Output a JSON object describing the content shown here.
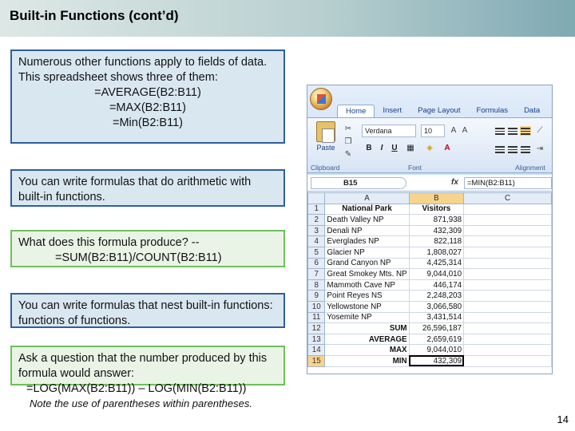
{
  "slide": {
    "title": "Built-in Functions (cont’d)",
    "page_number": "14",
    "note": "Note the use of parentheses within parentheses."
  },
  "boxes": {
    "b1": {
      "line1": "Numerous other functions apply to fields of data.  This spreadsheet shows three of them:",
      "f1": "=AVERAGE(B2:B11)",
      "f2": "=MAX(B2:B11)",
      "f3": "=Min(B2:B11)"
    },
    "b2": {
      "text": "You can write formulas that do arithmetic with built-in functions."
    },
    "b3": {
      "line1": "What does this formula produce? --",
      "formula": "=SUM(B2:B11)/COUNT(B2:B11)"
    },
    "b4": {
      "text": "You can write formulas that nest built-in functions: functions of functions."
    },
    "b5": {
      "line1": "Ask a question that the number produced by this  formula would answer:",
      "formula": "=LOG(MAX(B2:B11)) – LOG(MIN(B2:B11))"
    }
  },
  "excel": {
    "tabs": [
      "Home",
      "Insert",
      "Page Layout",
      "Formulas",
      "Data"
    ],
    "font_name": "Verdana",
    "font_size": "10",
    "paste_label": "Paste",
    "group_labels": {
      "clipboard": "Clipboard",
      "font": "Font",
      "alignment": "Alignment"
    },
    "name_box": "B15",
    "fx_label": "fx",
    "formula": "=MIN(B2:B11)",
    "col_headers": [
      "A",
      "B",
      "C"
    ],
    "rows": [
      {
        "n": "1",
        "a": "National Park",
        "b": "Visitors"
      },
      {
        "n": "2",
        "a": "Death Valley NP",
        "b": "871,938"
      },
      {
        "n": "3",
        "a": "Denali NP",
        "b": "432,309"
      },
      {
        "n": "4",
        "a": "Everglades NP",
        "b": "822,118"
      },
      {
        "n": "5",
        "a": "Glacier NP",
        "b": "1,808,027"
      },
      {
        "n": "6",
        "a": "Grand Canyon NP",
        "b": "4,425,314"
      },
      {
        "n": "7",
        "a": "Great Smokey Mts. NP",
        "b": "9,044,010"
      },
      {
        "n": "8",
        "a": "Mammoth Cave NP",
        "b": "446,174"
      },
      {
        "n": "9",
        "a": "Point Reyes NS",
        "b": "2,248,203"
      },
      {
        "n": "10",
        "a": "Yellowstone NP",
        "b": "3,066,580"
      },
      {
        "n": "11",
        "a": "Yosemite NP",
        "b": "3,431,514"
      },
      {
        "n": "12",
        "a": "SUM",
        "b": "26,596,187"
      },
      {
        "n": "13",
        "a": "AVERAGE",
        "b": "2,659,619"
      },
      {
        "n": "14",
        "a": "MAX",
        "b": "9,044,010"
      },
      {
        "n": "15",
        "a": "MIN",
        "b": "432,309"
      }
    ]
  }
}
